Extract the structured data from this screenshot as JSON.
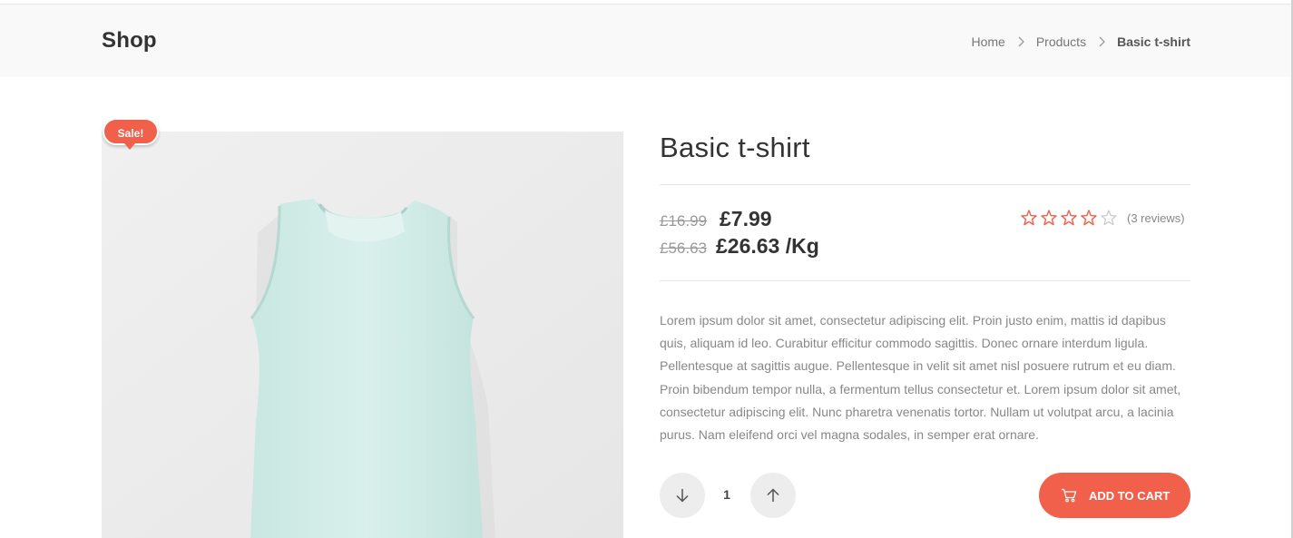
{
  "header": {
    "title": "Shop",
    "breadcrumb": [
      "Home",
      "Products",
      "Basic t-shirt"
    ]
  },
  "badge": {
    "label": "Sale!"
  },
  "product": {
    "name": "Basic t-shirt",
    "old_price": "£16.99",
    "price": "£7.99",
    "old_unit_price": "£56.63",
    "unit_price": "£26.63 /Kg",
    "rating": 4,
    "rating_max": 5,
    "reviews": "(3 reviews)",
    "description": "Lorem ipsum dolor sit amet, consectetur adipiscing elit. Proin justo enim, mattis id dapibus quis, aliquam id leo. Curabitur efficitur commodo sagittis. Donec ornare interdum ligula. Pellentesque at sagittis augue. Pellentesque in velit sit amet nisl posuere rutrum et eu diam. Proin bibendum tempor nulla, a fermentum tellus consectetur et. Lorem ipsum dolor sit amet, consectetur adipiscing elit. Nunc pharetra venenatis tortor. Nullam ut volutpat arcu, a lacinia purus. Nam eleifend orci vel magna sodales, in semper erat ornare."
  },
  "cart": {
    "quantity": "1",
    "add_label": "ADD TO CART"
  },
  "icons": {
    "decrease": "arrow-down-icon",
    "increase": "arrow-up-icon",
    "cart": "cart-icon",
    "star": "star-icon",
    "separator": "chevron-right-icon"
  },
  "colors": {
    "accent": "#f0604b",
    "header_bg": "#f9f9f9",
    "text_dark": "#333333",
    "text_muted": "#888888"
  }
}
